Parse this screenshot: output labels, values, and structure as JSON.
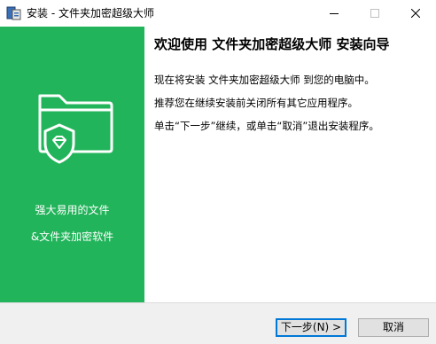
{
  "window": {
    "title": "安装 - 文件夹加密超级大师",
    "icon": "installer-app-icon"
  },
  "left_panel": {
    "background": "#22b45a",
    "illustration": "folder-shield-icon",
    "promo_line1": "强大易用的文件",
    "promo_line2": "&文件夹加密软件"
  },
  "content": {
    "heading": "欢迎使用 文件夹加密超级大师 安装向导",
    "para1": "现在将安装 文件夹加密超级大师          到您的电脑中。",
    "para2": "推荐您在继续安装前关闭所有其它应用程序。",
    "para3": "单击“下一步”继续，或单击“取消”退出安装程序。"
  },
  "buttons": {
    "next": "下一步(N) >",
    "cancel": "取消"
  }
}
